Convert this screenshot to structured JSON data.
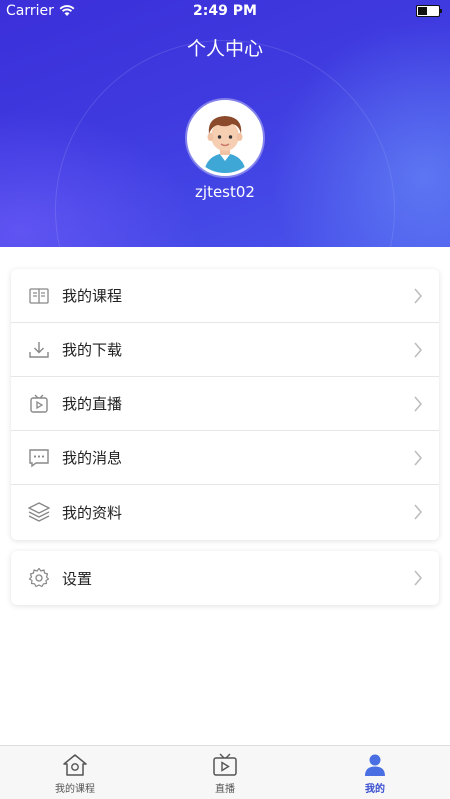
{
  "status_bar": {
    "carrier": "Carrier",
    "time": "2:49 PM"
  },
  "header": {
    "title": "个人中心",
    "username": "zjtest02"
  },
  "menu": {
    "items": [
      {
        "label": "我的课程",
        "icon": "book-icon"
      },
      {
        "label": "我的下载",
        "icon": "download-icon"
      },
      {
        "label": "我的直播",
        "icon": "live-tv-icon"
      },
      {
        "label": "我的消息",
        "icon": "message-icon"
      },
      {
        "label": "我的资料",
        "icon": "layers-icon"
      }
    ],
    "settings": {
      "label": "设置",
      "icon": "gear-icon"
    }
  },
  "tabbar": {
    "tabs": [
      {
        "label": "我的课程",
        "icon": "home-icon"
      },
      {
        "label": "直播",
        "icon": "tv-icon"
      },
      {
        "label": "我的",
        "icon": "user-icon",
        "active": true
      }
    ]
  },
  "colors": {
    "accent": "#3b4fd0",
    "header_start": "#3b2fd9",
    "header_end": "#4a55ec"
  }
}
